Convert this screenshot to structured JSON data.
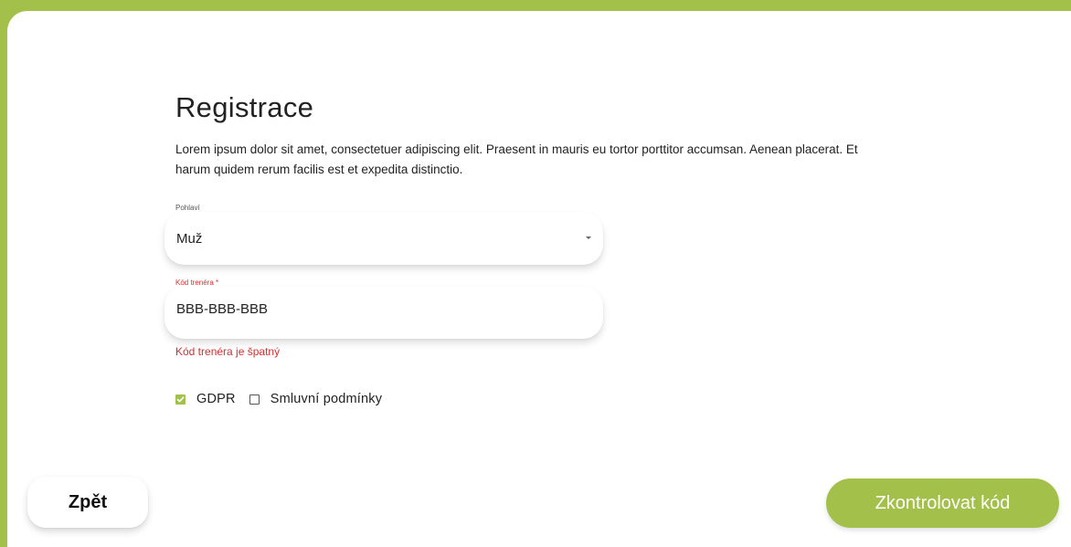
{
  "colors": {
    "accent": "#a3c14a",
    "error": "#d32f2f",
    "text": "#222222"
  },
  "header": {
    "title": "Registrace",
    "intro": "Lorem ipsum dolor sit amet, consectetuer adipiscing elit. Praesent in mauris eu tortor porttitor accumsan. Aenean placerat. Et harum quidem rerum facilis est et expedita distinctio."
  },
  "form": {
    "gender": {
      "label": "Pohlaví",
      "value": "Muž",
      "icon": "chevron-down-icon"
    },
    "trainer_code": {
      "label": "Kód trenéra *",
      "value": "BBB-BBB-BBB",
      "error": "Kód trenéra je špatný"
    },
    "consents": [
      {
        "label": "GDPR",
        "checked": true
      },
      {
        "label": "Smluvní podmínky",
        "checked": false
      }
    ]
  },
  "actions": {
    "back_label": "Zpět",
    "submit_label": "Zkontrolovat kód"
  }
}
